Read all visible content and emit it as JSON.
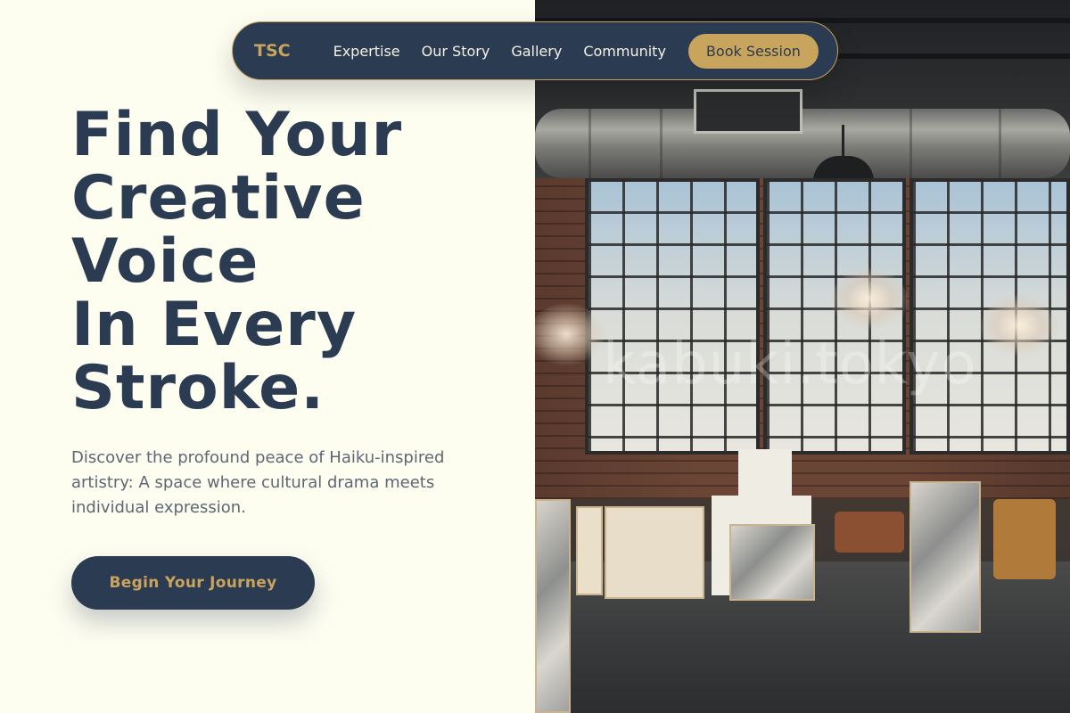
{
  "nav": {
    "logo": "TSC",
    "links": [
      "Expertise",
      "Our Story",
      "Gallery",
      "Community"
    ],
    "cta": "Book Session"
  },
  "hero": {
    "headline_lines": [
      "Find Your",
      "Creative",
      "Voice",
      "In Every",
      "Stroke."
    ],
    "subtext": "Discover the profound peace of Haiku-inspired artistry: A space where cultural drama meets individual expression.",
    "cta": "Begin Your Journey"
  },
  "image": {
    "watermark": "kabuki.tokyo"
  },
  "colors": {
    "navy": "#2b3b52",
    "gold": "#c9a45c",
    "cream": "#fdfdf0"
  }
}
